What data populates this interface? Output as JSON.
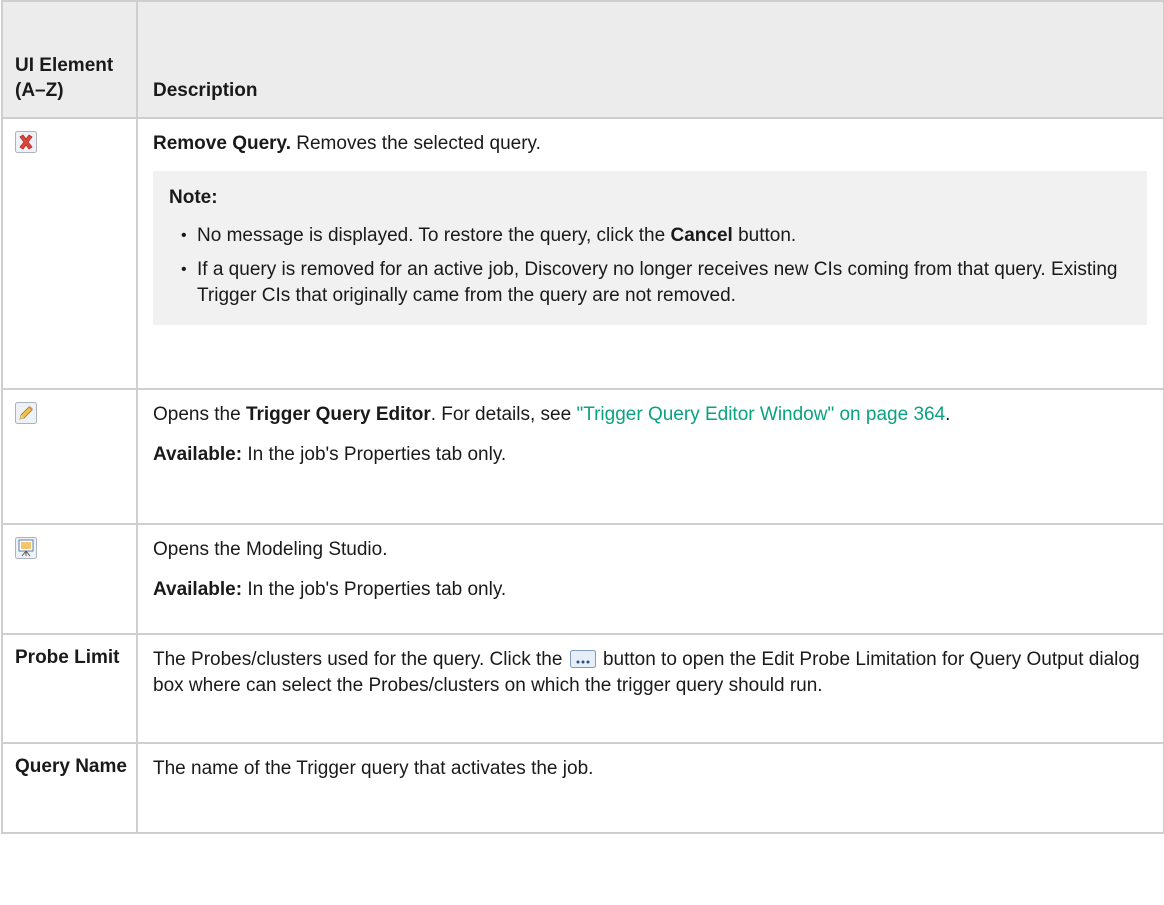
{
  "header": {
    "col1": "UI Element (A–Z)",
    "col2": "Description"
  },
  "rows": [
    {
      "element_icon": "remove-query-icon",
      "lead_bold": "Remove Query.",
      "lead_text": " Removes the selected query.",
      "note": {
        "title": "Note:",
        "item1_pre": "No message is displayed. To restore the query, click the ",
        "item1_bold": "Cancel",
        "item1_post": " button.",
        "item2": "If a query is removed for an active job, Discovery no longer receives new CIs coming from that query. Existing Trigger CIs that originally came from the query are not removed."
      }
    },
    {
      "element_icon": "edit-pencil-icon",
      "pre": "Opens the ",
      "bold": "Trigger Query Editor",
      "mid": ". For details, see ",
      "link": "\"Trigger Query Editor Window\" on page 364",
      "post": ".",
      "avail_label": "Available:",
      "avail_text": " In the job's Properties tab only."
    },
    {
      "element_icon": "modeling-studio-icon",
      "text": "Opens the Modeling Studio.",
      "avail_label": "Available:",
      "avail_text": " In the job's Properties tab only."
    },
    {
      "element": "Probe Limit",
      "pre": "The Probes/clusters used for the query. Click the ",
      "button_icon": "ellipsis-button-icon",
      "post": " button to open the Edit Probe Limitation for Query Output dialog box where can select the Probes/clusters on which the trigger query should run."
    },
    {
      "element": "Query Name",
      "text": "The name of the Trigger query that activates the job."
    }
  ],
  "colors": {
    "link": "#0aa37f",
    "header_bg": "#ececec",
    "note_bg": "#f1f1f1",
    "border": "#cfcfcf"
  }
}
